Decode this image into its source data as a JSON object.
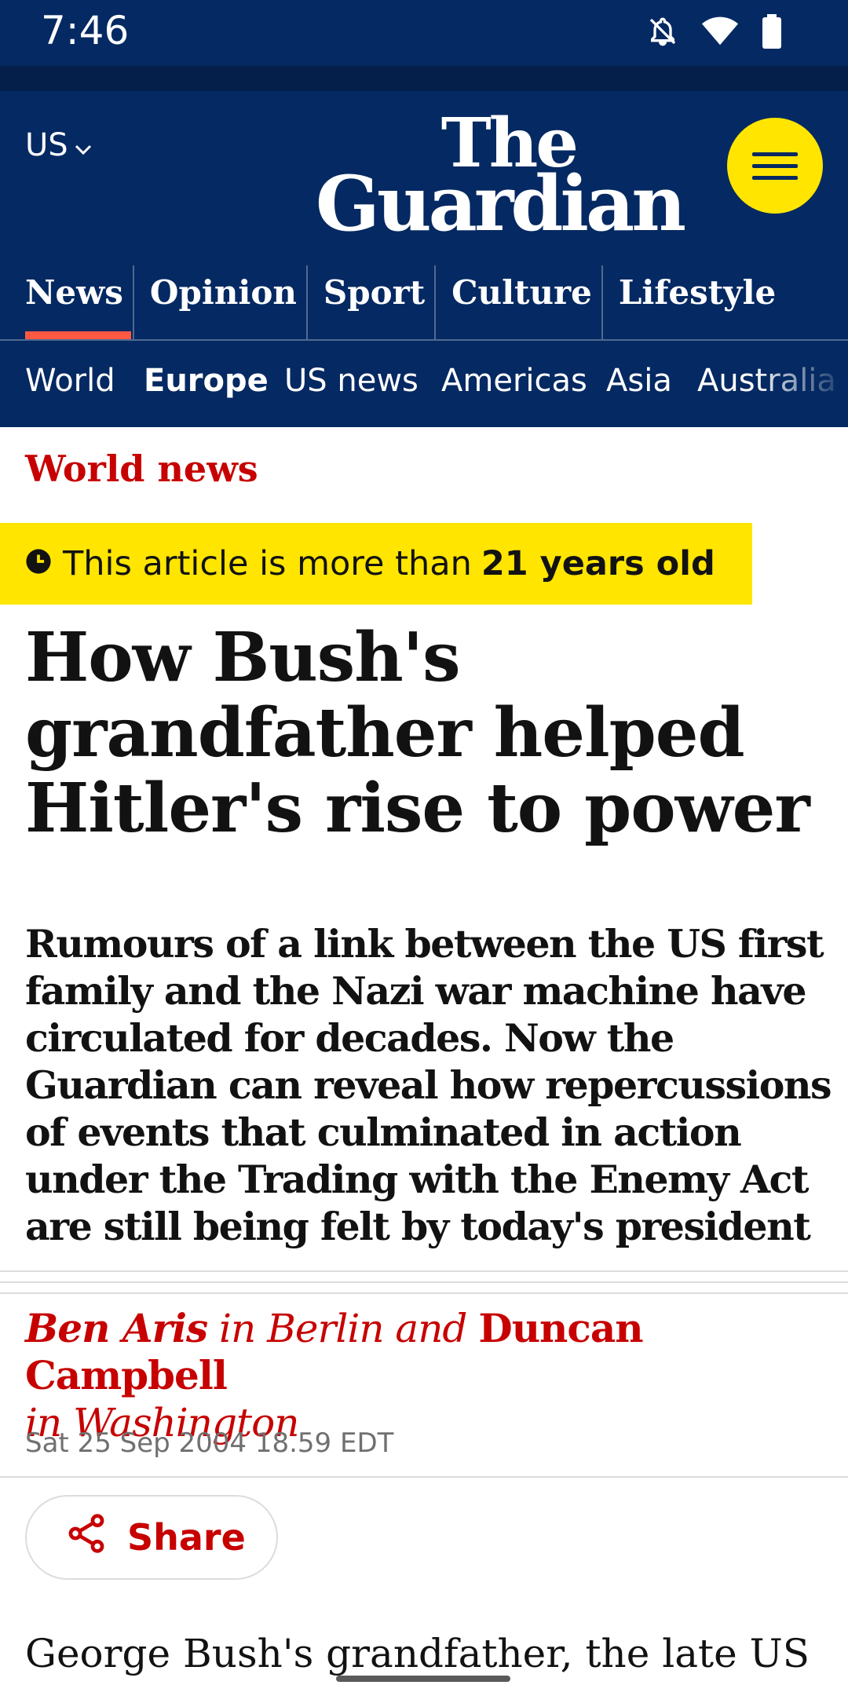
{
  "status_bar": {
    "time": "7:46"
  },
  "header": {
    "edition": "US",
    "logo_line1": "The",
    "logo_line2": "Guardian",
    "pillars": [
      {
        "label": "News",
        "active": true
      },
      {
        "label": "Opinion"
      },
      {
        "label": "Sport"
      },
      {
        "label": "Culture"
      },
      {
        "label": "Lifestyle"
      }
    ]
  },
  "subnav": {
    "items": [
      {
        "label": "World"
      },
      {
        "label": "Europe",
        "active": true
      },
      {
        "label": "US news"
      },
      {
        "label": "Americas"
      },
      {
        "label": "Asia"
      },
      {
        "label": "Australia"
      }
    ]
  },
  "article": {
    "section": "World news",
    "age_warning_prefix": "This article is more than",
    "age_warning_age": "21 years old",
    "headline": "How Bush's grandfather helped Hitler's rise to power",
    "standfirst": "Rumours of a link between the US first family and the Nazi war machine have circulated for decades. Now the Guardian can reveal how repercussions of events that culminated in action under the Trading with the Enemy Act are still being felt by today's president",
    "byline": {
      "author1": "Ben Aris",
      "in1": " in Berlin and ",
      "author2": "Duncan Campbell",
      "in2": "in Washington"
    },
    "date": "Sat 25 Sep 2004 18.59 EDT",
    "share_label": "Share",
    "body_start": "George Bush's grandfather, the late US"
  },
  "colors": {
    "brand_navy": "#052962",
    "news_red": "#c70000",
    "highlight_yellow": "#ffe500",
    "active_underline": "#ff5943"
  }
}
